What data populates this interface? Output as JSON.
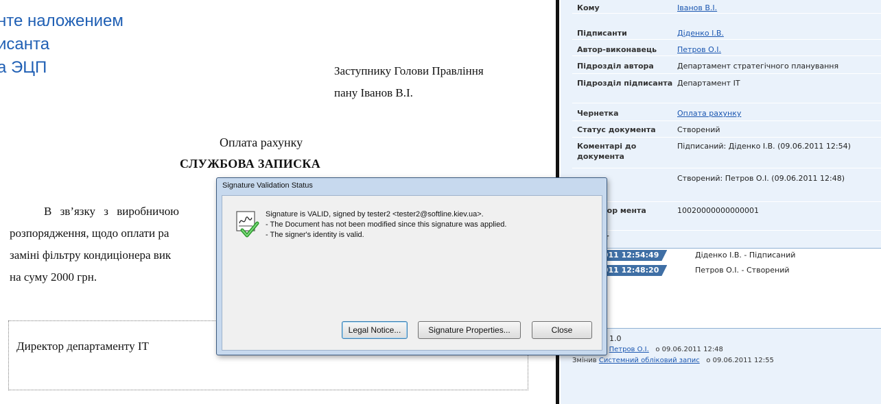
{
  "slide": {
    "heading_lines": [
      "нте наложением",
      "исанта",
      "а ЭЦП"
    ]
  },
  "document": {
    "addressee_line1": "Заступнику Голови Правління",
    "addressee_line2": "пану Іванов В.І.",
    "subject": "Оплата рахунку",
    "doc_type": "СЛУЖБОВА ЗАПИСКА",
    "body_lines": [
      "В зв’язку з виробничою",
      "розпорядження, щодо оплати ра",
      "заміні фільтру кондиціонера вик",
      "на суму 2000 грн."
    ],
    "signature_label": "Директор департаменту IT"
  },
  "panel": {
    "rows": [
      {
        "label": "Кому",
        "value": "Іванов В.І.",
        "link": true
      },
      {
        "label": "Підписанти",
        "value": "Діденко І.В.",
        "link": true
      },
      {
        "label": "Автор-виконавець",
        "value": "Петров О.І.",
        "link": true
      },
      {
        "label": "Підрозділ автора",
        "value": "Департамент стратегічного планування",
        "link": false
      },
      {
        "label": "Підрозділ підписанта",
        "value": "Департамент IT",
        "link": false
      },
      {
        "label": "Чернетка",
        "value": "Оплата рахунку",
        "link": true
      },
      {
        "label": "Статус документа",
        "value": "Створений",
        "link": false
      },
      {
        "label": "Коментарі до документа",
        "value": "Підписаний: Діденко І.В. (09.06.2011 12:54)",
        "link": false
      },
      {
        "label": "",
        "value": "Створений: Петров О.І. (09.06.2011 12:48)",
        "link": false
      },
      {
        "label": "ифікатор мента",
        "value": "10020000000000001",
        "link": false
      }
    ],
    "history_label": "т",
    "history": [
      {
        "date": ".2011 12:54:49",
        "text": "Діденко І.В. - Підписаний"
      },
      {
        "date": ".2011 12:48:20",
        "text": "Петров О.І. - Створений"
      }
    ],
    "version": "1.0",
    "changed_1": {
      "prefix": "ив",
      "user": "Петров О.І.",
      "date": "о 09.06.2011 12:48"
    },
    "changed_2": {
      "prefix": "Змінив",
      "user": "Системний обліковий запис",
      "date": "о 09.06.2011 12:55"
    }
  },
  "dialog": {
    "title": "Signature Validation Status",
    "message_lines": [
      "Signature is VALID, signed by tester2 <tester2@softline.kiev.ua>.",
      "- The Document has not been modified since this signature was applied.",
      "- The signer's identity is valid."
    ],
    "buttons": {
      "legal_notice": "Legal Notice...",
      "signature_properties": "Signature Properties...",
      "close": "Close"
    }
  },
  "colors": {
    "slide_heading": "#1f5fb4",
    "panel_bg": "#eaf2fb",
    "link": "#1a56b0",
    "history_date_bg": "#3f6fa5",
    "dialog_frame": "#c7d9ee"
  }
}
